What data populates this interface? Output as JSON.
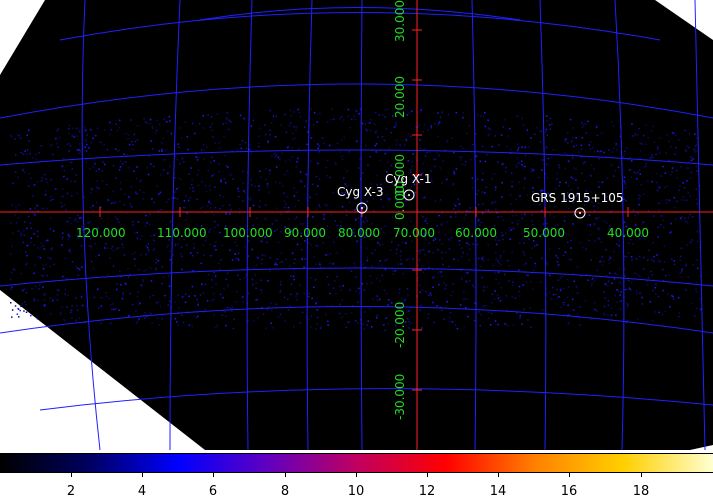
{
  "image": {
    "axis_labels": {
      "longitude": [
        "120.000",
        "110.000",
        "100.000",
        "90.000",
        "80.000",
        "70.000",
        "60.000",
        "50.000",
        "40.000"
      ],
      "latitude": [
        "30.000",
        "20.000",
        "10.000",
        "0.000",
        "-20.000",
        "-30.000"
      ]
    },
    "sources": [
      {
        "name": "Cyg X-3"
      },
      {
        "name": "Cyg X-1"
      },
      {
        "name": "GRS 1915+105"
      }
    ],
    "colors": {
      "grid": "#2020ff",
      "crosshair": "#ff2020",
      "axis_label": "#22dd22",
      "source_label": "#ffffff",
      "background": "#000000"
    }
  },
  "colorbar": {
    "tick_labels": [
      "2",
      "4",
      "6",
      "8",
      "10",
      "12",
      "14",
      "16",
      "18"
    ],
    "gradient_colors": [
      "#000000",
      "#000060",
      "#0000ff",
      "#6000c0",
      "#c00060",
      "#ff0000",
      "#ff8000",
      "#ffd000",
      "#ffffd0"
    ]
  }
}
